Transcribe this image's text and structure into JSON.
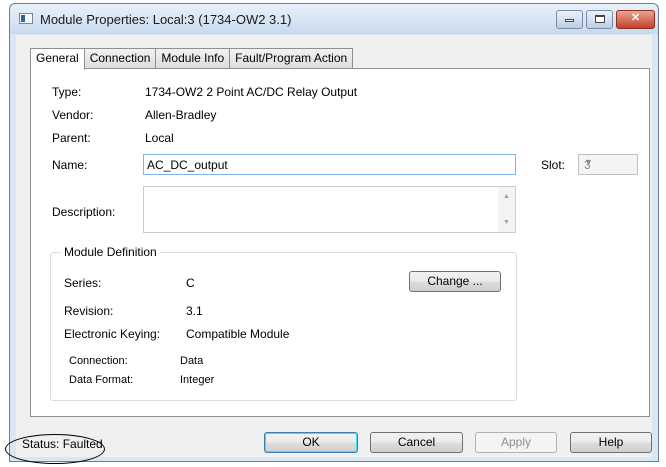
{
  "window": {
    "title": "Module Properties: Local:3 (1734-OW2 3.1)"
  },
  "tabs": [
    "General",
    "Connection",
    "Module Info",
    "Fault/Program Action"
  ],
  "general": {
    "type_label": "Type:",
    "type_value": "1734-OW2 2 Point AC/DC Relay Output",
    "vendor_label": "Vendor:",
    "vendor_value": "Allen-Bradley",
    "parent_label": "Parent:",
    "parent_value": "Local",
    "name_label": "Name:",
    "name_value": "AC_DC_output",
    "slot_label": "Slot:",
    "slot_value": "3",
    "description_label": "Description:",
    "description_value": ""
  },
  "module_definition": {
    "title": "Module Definition",
    "series_label": "Series:",
    "series_value": "C",
    "change_button": "Change ...",
    "revision_label": "Revision:",
    "revision_value": "3.1",
    "keying_label": "Electronic Keying:",
    "keying_value": "Compatible Module",
    "connection_label": "Connection:",
    "connection_value": "Data",
    "data_format_label": "Data Format:",
    "data_format_value": "Integer"
  },
  "footer": {
    "status_text": "Status:  Faulted",
    "ok": "OK",
    "cancel": "Cancel",
    "apply": "Apply",
    "help": "Help"
  }
}
